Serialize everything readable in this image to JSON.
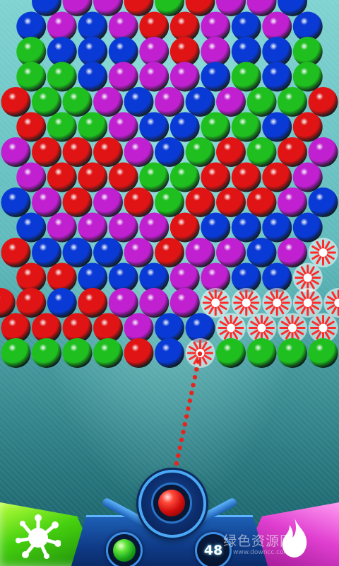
{
  "game": {
    "shots_remaining": "48",
    "current_ball_color": "red",
    "next_ball_color": "green",
    "watermark": "绿色资源网",
    "watermark_sub": "www.downcc.com"
  },
  "colors": {
    "R": "#e01414",
    "G": "#1fbf1f",
    "B": "#0a3ad6",
    "P": "#c020d0",
    "S": "#ff3a3a"
  },
  "bubble_grid": [
    "BPPRGRPPB",
    "BPBPRRPBPB",
    "GBBBPRPBBG",
    "GGBPPPBGBG",
    "RGGPBPBPGGR",
    "RGGPBBGGBR",
    "PRRRPBGRGRP",
    "PRRRGGRRRP",
    "BPRPRGRRRPB",
    "BPPPPRBBBB",
    "RBBBPRPPBPS",
    "RRBBBPPBBS",
    "RRBRPPPSSSSS",
    "RRRRPBBSSSS",
    "GGGGRBSGGGG"
  ],
  "aim_line": {
    "color": "#e8231c"
  }
}
